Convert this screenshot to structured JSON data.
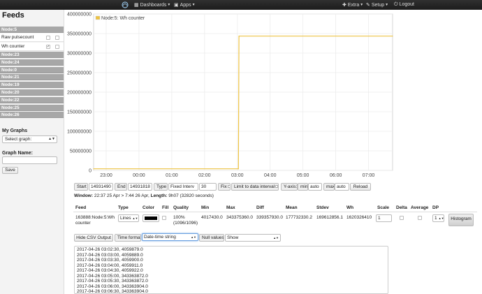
{
  "topbar": {
    "dashboards": "Dashboards",
    "apps": "Apps",
    "extra": "Extra",
    "setup": "Setup",
    "logout": "Logout"
  },
  "sidebar": {
    "title": "Feeds",
    "groups_top": [
      "Node:5"
    ],
    "feeds": [
      {
        "name": "Raw pulsecount",
        "left_checked": false,
        "right_checked": false
      },
      {
        "name": "Wh counter",
        "left_checked": true,
        "right_checked": false
      }
    ],
    "groups_rest": [
      "Node:23",
      "Node:24",
      "Node:0",
      "Node:21",
      "Node:19",
      "Node:20",
      "Node:22",
      "Node:25",
      "Node:26"
    ],
    "mygraphs_title": "My Graphs",
    "graph_select_value": "Select graph:",
    "graph_name_label": "Graph Name:",
    "graph_name_value": "",
    "save_label": "Save"
  },
  "chart_data": {
    "type": "line",
    "series": [
      {
        "name": "Node:5: Wh counter",
        "color": "#edc240",
        "points": [
          [
            "22:37",
            4059879
          ],
          [
            "03:02",
            4059879
          ],
          [
            "03:03",
            343363872
          ],
          [
            "07:44",
            343363904
          ]
        ]
      }
    ],
    "x_ticks": [
      "23:00",
      "00:00",
      "01:00",
      "02:00",
      "03:00",
      "04:00",
      "05:00",
      "06:00",
      "07:00"
    ],
    "y_ticks": [
      "0",
      "50000000",
      "100000000",
      "150000000",
      "200000000",
      "250000000",
      "300000000",
      "350000000",
      "400000000"
    ],
    "ylim": [
      0,
      400000000
    ],
    "grid": true,
    "legend_position": "top-left"
  },
  "controls": {
    "start_label": "Start",
    "start_value": "14931490",
    "end_label": "End",
    "end_value": "14931818",
    "type_label": "Type",
    "type_value": "Fixed Interv",
    "interval_value": "30",
    "fix_label": "Fix",
    "limit_label": "Limit to data interval",
    "yaxis_label": "Y-axis:",
    "min_label": "min",
    "min_value": "auto",
    "max_label": "max",
    "max_value": "auto",
    "reload_label": "Reload"
  },
  "window_info": {
    "window_label": "Window:",
    "window_value": "22:37 25 Apr > 7:44 26 Apr,",
    "length_label": "Length:",
    "length_value": "9h07 (32820 seconds)"
  },
  "feed_table": {
    "headers": {
      "feed": "Feed",
      "type": "Type",
      "color": "Color",
      "fill": "Fill",
      "quality": "Quality",
      "min": "Min",
      "max": "Max",
      "diff": "Diff",
      "mean": "Mean",
      "stdev": "Stdev",
      "wh": "Wh",
      "scale": "Scale",
      "delta": "Delta",
      "average": "Average",
      "dp": "DP"
    },
    "row": {
      "feed_line1": "163888:Node:5:Wh",
      "feed_line2": "counter",
      "type": "Lines",
      "color": "#000000",
      "quality_line1": "100%",
      "quality_line2": "(1096/1096)",
      "min": "4017430.0",
      "max": "343375360.0",
      "diff": "339357930.0",
      "mean": "177732330.2",
      "stdev": "169612856.1",
      "wh": "1620326410",
      "scale": "1",
      "dp": "1",
      "histogram": "Histogram"
    }
  },
  "csv": {
    "hide_label": "Hide CSV Output",
    "time_format_label": "Time format:",
    "time_format_value": "Date-time string",
    "null_values_label": "Null values:",
    "null_values_value": "Show",
    "lines": [
      "2017-04-26 03:02:30, 4059879.0",
      "2017-04-26 03:03:00, 4059889.0",
      "2017-04-26 03:03:30, 4059900.0",
      "2017-04-26 03:04:00, 4059911.0",
      "2017-04-26 03:04:30, 4059922.0",
      "2017-04-26 03:05:00, 343363872.0",
      "2017-04-26 03:05:30, 343363872.0",
      "2017-04-26 03:06:00, 343363904.0",
      "2017-04-26 03:06:30, 343363904.0"
    ]
  }
}
